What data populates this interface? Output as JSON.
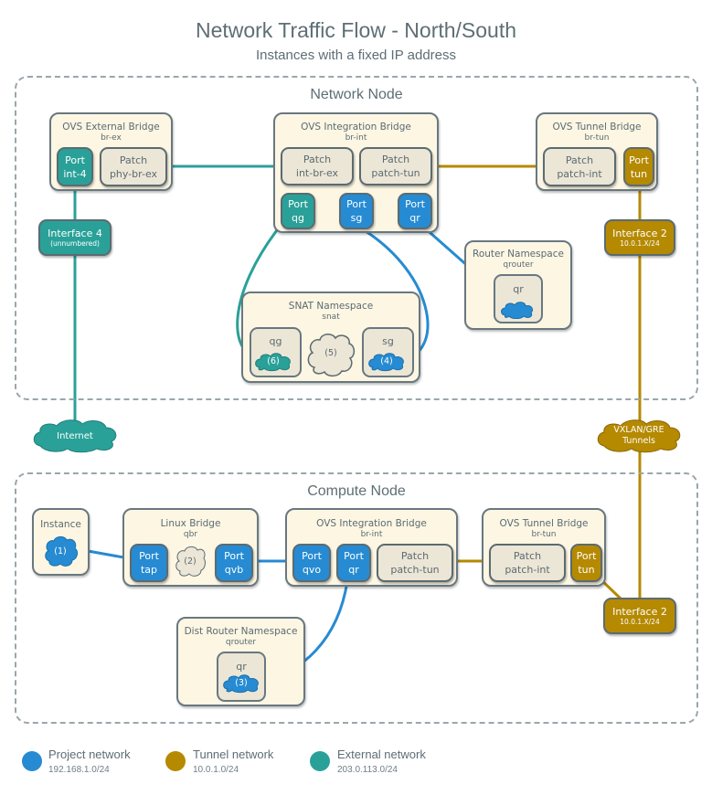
{
  "title": "Network Traffic Flow - North/South",
  "subtitle": "Instances with a fixed IP address",
  "colors": {
    "project": "#268bd2",
    "tunnel": "#b58900",
    "external": "#2aa198",
    "patch": "#ece6d6",
    "box": "#fdf6e3"
  },
  "network_node": {
    "title": "Network Node",
    "ext_bridge": {
      "title": "OVS External Bridge",
      "sub": "br-ex",
      "port": [
        "Port",
        "int-4"
      ],
      "patch": [
        "Patch",
        "phy-br-ex"
      ]
    },
    "int_bridge": {
      "title": "OVS Integration Bridge",
      "sub": "br-int",
      "patch1": [
        "Patch",
        "int-br-ex"
      ],
      "patch2": [
        "Patch",
        "patch-tun"
      ],
      "port_qg": [
        "Port",
        "qg"
      ],
      "port_sg": [
        "Port",
        "sg"
      ],
      "port_qr": [
        "Port",
        "qr"
      ]
    },
    "tun_bridge": {
      "title": "OVS Tunnel Bridge",
      "sub": "br-tun",
      "patch": [
        "Patch",
        "patch-int"
      ],
      "port": [
        "Port",
        "tun"
      ]
    },
    "iface4": {
      "name": "Interface 4",
      "detail": "(unnumbered)"
    },
    "iface2": {
      "name": "Interface 2",
      "detail": "10.0.1.X/24"
    },
    "router_ns": {
      "title": "Router Namespace",
      "sub": "qrouter",
      "inner": "qr"
    },
    "snat_ns": {
      "title": "SNAT Namespace",
      "sub": "snat",
      "qg": "qg",
      "sg": "sg",
      "step6": "(6)",
      "step5": "(5)",
      "step4": "(4)"
    }
  },
  "clouds": {
    "internet": "Internet",
    "tunnels_line1": "VXLAN/GRE",
    "tunnels_line2": "Tunnels"
  },
  "compute_node": {
    "title": "Compute Node",
    "instance": {
      "title": "Instance",
      "step": "(1)"
    },
    "linux_bridge": {
      "title": "Linux Bridge",
      "sub": "qbr",
      "port_tap": [
        "Port",
        "tap"
      ],
      "step": "(2)",
      "port_qvb": [
        "Port",
        "qvb"
      ]
    },
    "int_bridge": {
      "title": "OVS Integration Bridge",
      "sub": "br-int",
      "port_qvo": [
        "Port",
        "qvo"
      ],
      "port_qr": [
        "Port",
        "qr"
      ],
      "patch": [
        "Patch",
        "patch-tun"
      ]
    },
    "tun_bridge": {
      "title": "OVS Tunnel Bridge",
      "sub": "br-tun",
      "patch": [
        "Patch",
        "patch-int"
      ],
      "port": [
        "Port",
        "tun"
      ]
    },
    "iface2": {
      "name": "Interface 2",
      "detail": "10.0.1.X/24"
    },
    "dist_router": {
      "title": "Dist Router Namespace",
      "sub": "qrouter",
      "inner": "qr",
      "step": "(3)"
    }
  },
  "legend": [
    {
      "label": "Project network",
      "sub": "192.168.1.0/24",
      "color": "#268bd2"
    },
    {
      "label": "Tunnel network",
      "sub": "10.0.1.0/24",
      "color": "#b58900"
    },
    {
      "label": "External network",
      "sub": "203.0.113.0/24",
      "color": "#2aa198"
    }
  ]
}
